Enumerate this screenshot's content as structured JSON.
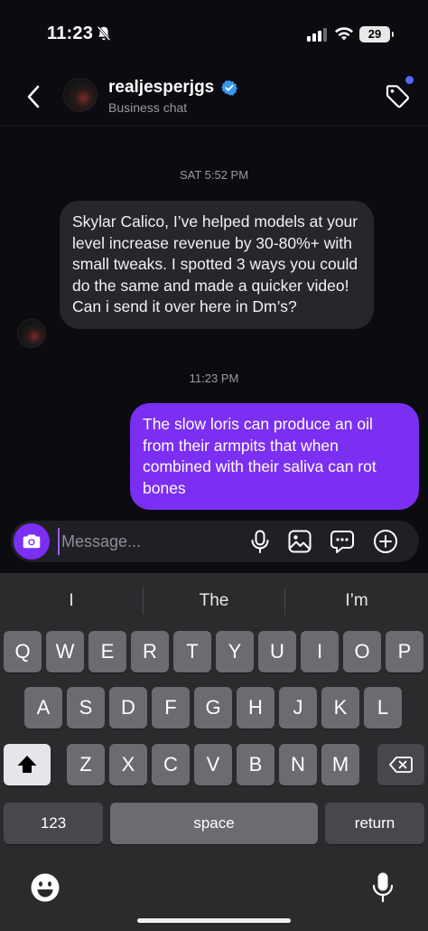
{
  "status_bar": {
    "time": "11:23",
    "battery": "29"
  },
  "header": {
    "username": "realjesperjgs",
    "subtitle": "Business chat"
  },
  "chat": {
    "timestamp_1": "SAT 5:52 PM",
    "incoming_message": "Skylar Calico, I’ve helped models at your level increase revenue by 30-80%+ with small tweaks. I spotted 3 ways you could do the same and made a quicker video! Can i send it over here in Dm’s?",
    "timestamp_2": "11:23 PM",
    "outgoing_message": "The slow loris can produce an oil from their armpits that when combined with their saliva can rot bones"
  },
  "composer": {
    "placeholder": "Message..."
  },
  "keyboard": {
    "suggestions": [
      "I",
      "The",
      "I’m"
    ],
    "row1": [
      "Q",
      "W",
      "E",
      "R",
      "T",
      "Y",
      "U",
      "I",
      "O",
      "P"
    ],
    "row2": [
      "A",
      "S",
      "D",
      "F",
      "G",
      "H",
      "J",
      "K",
      "L"
    ],
    "row3": [
      "Z",
      "X",
      "C",
      "V",
      "B",
      "N",
      "M"
    ],
    "numbers_label": "123",
    "space_label": "space",
    "return_label": "return"
  },
  "colors": {
    "accent": "#7b2ff2",
    "verified": "#3897f0",
    "background": "#0b0b10"
  }
}
